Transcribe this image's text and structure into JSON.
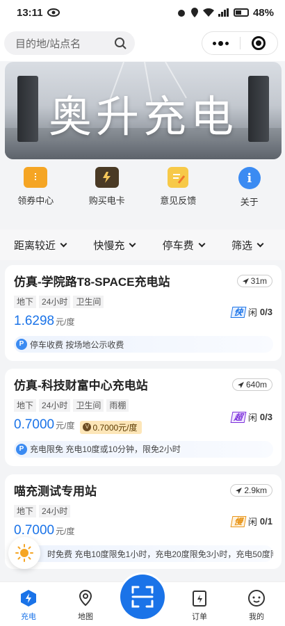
{
  "status": {
    "time": "13:11",
    "battery": "48%"
  },
  "search": {
    "placeholder": "目的地/站点名"
  },
  "banner": {
    "title": "奥升充电"
  },
  "quick_actions": [
    {
      "label": "领券中心",
      "icon": "coupon-icon"
    },
    {
      "label": "购买电卡",
      "icon": "card-icon"
    },
    {
      "label": "意见反馈",
      "icon": "feedback-icon"
    },
    {
      "label": "关于",
      "icon": "info-icon"
    }
  ],
  "filters": [
    "距离较近",
    "快慢充",
    "停车费",
    "筛选"
  ],
  "stations": [
    {
      "name": "仿真-学院路T8-SPACE充电站",
      "distance": "31m",
      "tags": [
        "地下",
        "24小时",
        "卫生间"
      ],
      "price": "1.6298",
      "unit": "元/度",
      "speed_label": "快",
      "speed_type": "fast",
      "idle_label": "闲",
      "idle": "0/3",
      "parking": "停车收费 按场地公示收费"
    },
    {
      "name": "仿真-科技财富中心充电站",
      "distance": "640m",
      "tags": [
        "地下",
        "24小时",
        "卫生间",
        "雨棚"
      ],
      "price": "0.7000",
      "unit": "元/度",
      "member_price": "0.7000元/度",
      "speed_label": "超",
      "speed_type": "super",
      "idle_label": "闲",
      "idle": "0/3",
      "parking": "充电限免 充电10度或10分钟，限免2小时"
    },
    {
      "name": "喵充测试专用站",
      "distance": "2.9km",
      "tags": [
        "地下",
        "24小时"
      ],
      "price": "0.7000",
      "unit": "元/度",
      "speed_label": "慢",
      "speed_type": "slow",
      "idle_label": "闲",
      "idle": "0/1",
      "parking": "时免费 充电10度限免1小时，充电20度限免3小时，充电50度限..."
    }
  ],
  "tabs": [
    {
      "label": "充电",
      "icon": "charge-icon"
    },
    {
      "label": "地图",
      "icon": "map-icon"
    },
    {
      "label": "订单",
      "icon": "order-icon"
    },
    {
      "label": "我的",
      "icon": "profile-icon"
    }
  ],
  "colors": {
    "accent": "#1a73e8"
  }
}
